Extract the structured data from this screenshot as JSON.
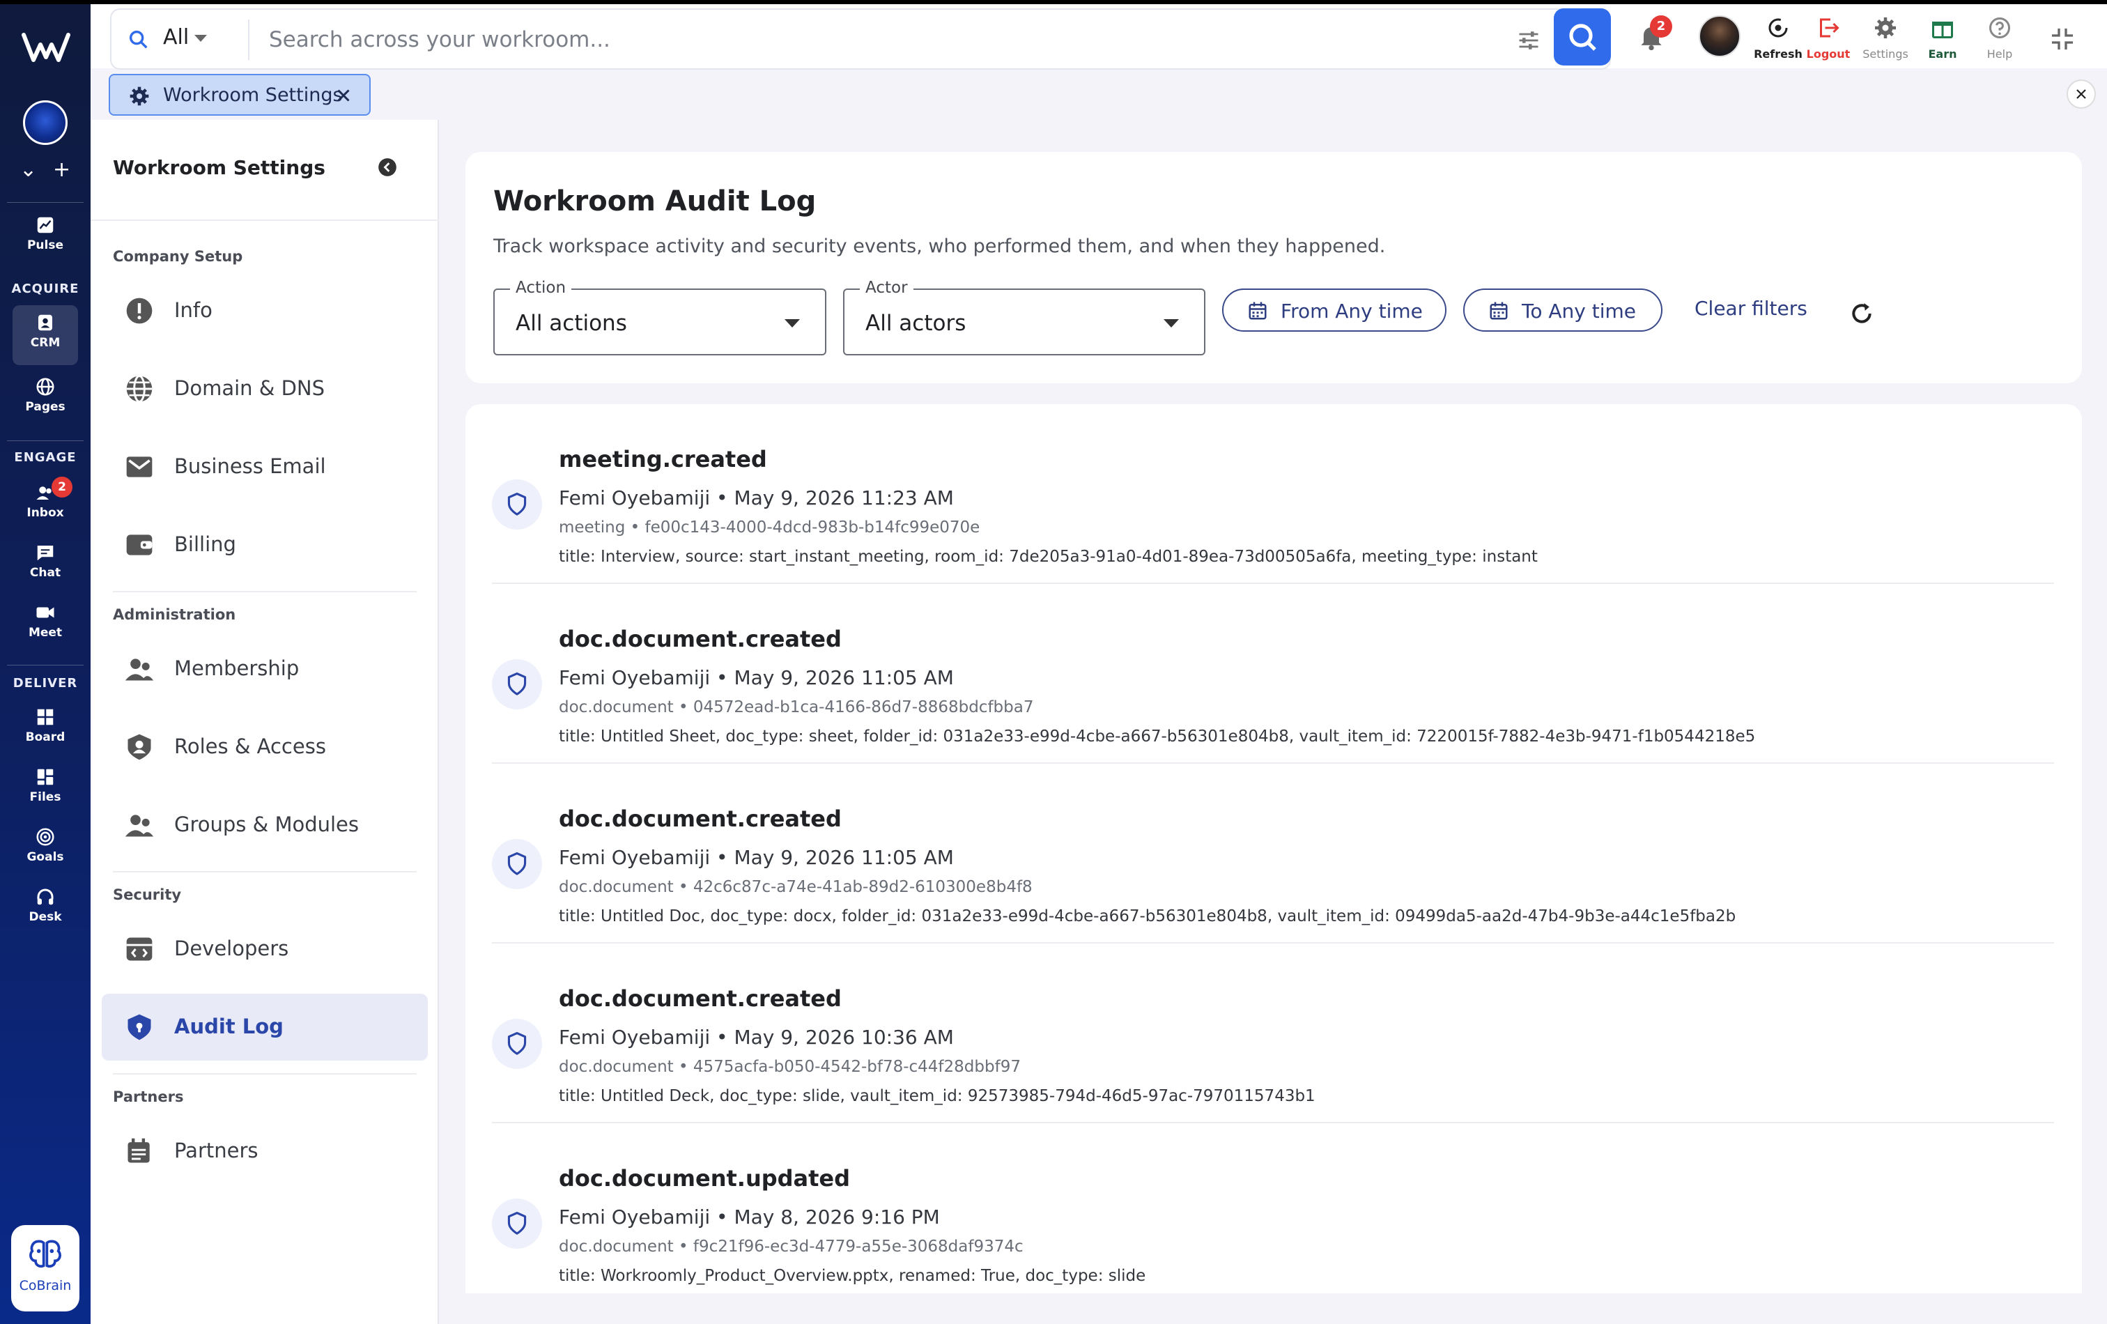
{
  "rail": {
    "sections": {
      "acquire": "ACQUIRE",
      "engage": "ENGAGE",
      "deliver": "DELIVER"
    },
    "items": {
      "pulse": "Pulse",
      "crm": "CRM",
      "pages": "Pages",
      "inbox": "Inbox",
      "inbox_badge": "2",
      "chat": "Chat",
      "meet": "Meet",
      "board": "Board",
      "files": "Files",
      "goals": "Goals",
      "desk": "Desk"
    },
    "cobrain": "CoBrain"
  },
  "topbar": {
    "scope": "All",
    "search_placeholder": "Search across your workroom...",
    "notif_badge": "2",
    "actions": {
      "refresh": "Refresh",
      "logout": "Logout",
      "settings": "Settings",
      "earn": "Earn",
      "help": "Help"
    }
  },
  "tab": {
    "label": "Workroom Settings"
  },
  "sidebar": {
    "title": "Workroom Settings",
    "groups": {
      "company": "Company Setup",
      "admin": "Administration",
      "security": "Security",
      "partners": "Partners"
    },
    "items": {
      "info": "Info",
      "domain": "Domain & DNS",
      "email": "Business Email",
      "billing": "Billing",
      "membership": "Membership",
      "roles": "Roles & Access",
      "groups": "Groups & Modules",
      "developers": "Developers",
      "audit": "Audit Log",
      "partners": "Partners"
    }
  },
  "audit": {
    "title": "Workroom Audit Log",
    "subtitle": "Track workspace activity and security events, who performed them, and when they happened.",
    "filters": {
      "action_label": "Action",
      "action_value": "All actions",
      "actor_label": "Actor",
      "actor_value": "All actors",
      "from": "From Any time",
      "to": "To Any time",
      "clear": "Clear filters"
    },
    "rows": [
      {
        "event": "meeting.created",
        "who": "Femi Oyebamiji • May 9, 2026 11:23 AM",
        "entity": "meeting • fe00c143-4000-4dcd-983b-b14fc99e070e",
        "details": "title: Interview, source: start_instant_meeting, room_id: 7de205a3-91a0-4d01-89ea-73d00505a6fa, meeting_type: instant"
      },
      {
        "event": "doc.document.created",
        "who": "Femi Oyebamiji • May 9, 2026 11:05 AM",
        "entity": "doc.document • 04572ead-b1ca-4166-86d7-8868bdcfbba7",
        "details": "title: Untitled Sheet, doc_type: sheet, folder_id: 031a2e33-e99d-4cbe-a667-b56301e804b8, vault_item_id: 7220015f-7882-4e3b-9471-f1b0544218e5"
      },
      {
        "event": "doc.document.created",
        "who": "Femi Oyebamiji • May 9, 2026 11:05 AM",
        "entity": "doc.document • 42c6c87c-a74e-41ab-89d2-610300e8b4f8",
        "details": "title: Untitled Doc, doc_type: docx, folder_id: 031a2e33-e99d-4cbe-a667-b56301e804b8, vault_item_id: 09499da5-aa2d-47b4-9b3e-a44c1e5fba2b"
      },
      {
        "event": "doc.document.created",
        "who": "Femi Oyebamiji • May 9, 2026 10:36 AM",
        "entity": "doc.document • 4575acfa-b050-4542-bf78-c44f28dbbf97",
        "details": "title: Untitled Deck, doc_type: slide, vault_item_id: 92573985-794d-46d5-97ac-7970115743b1"
      },
      {
        "event": "doc.document.updated",
        "who": "Femi Oyebamiji • May 8, 2026 9:16 PM",
        "entity": "doc.document • f9c21f96-ec3d-4779-a55e-3068daf9374c",
        "details": "title: Workroomly_Product_Overview.pptx, renamed: True, doc_type: slide"
      }
    ]
  }
}
